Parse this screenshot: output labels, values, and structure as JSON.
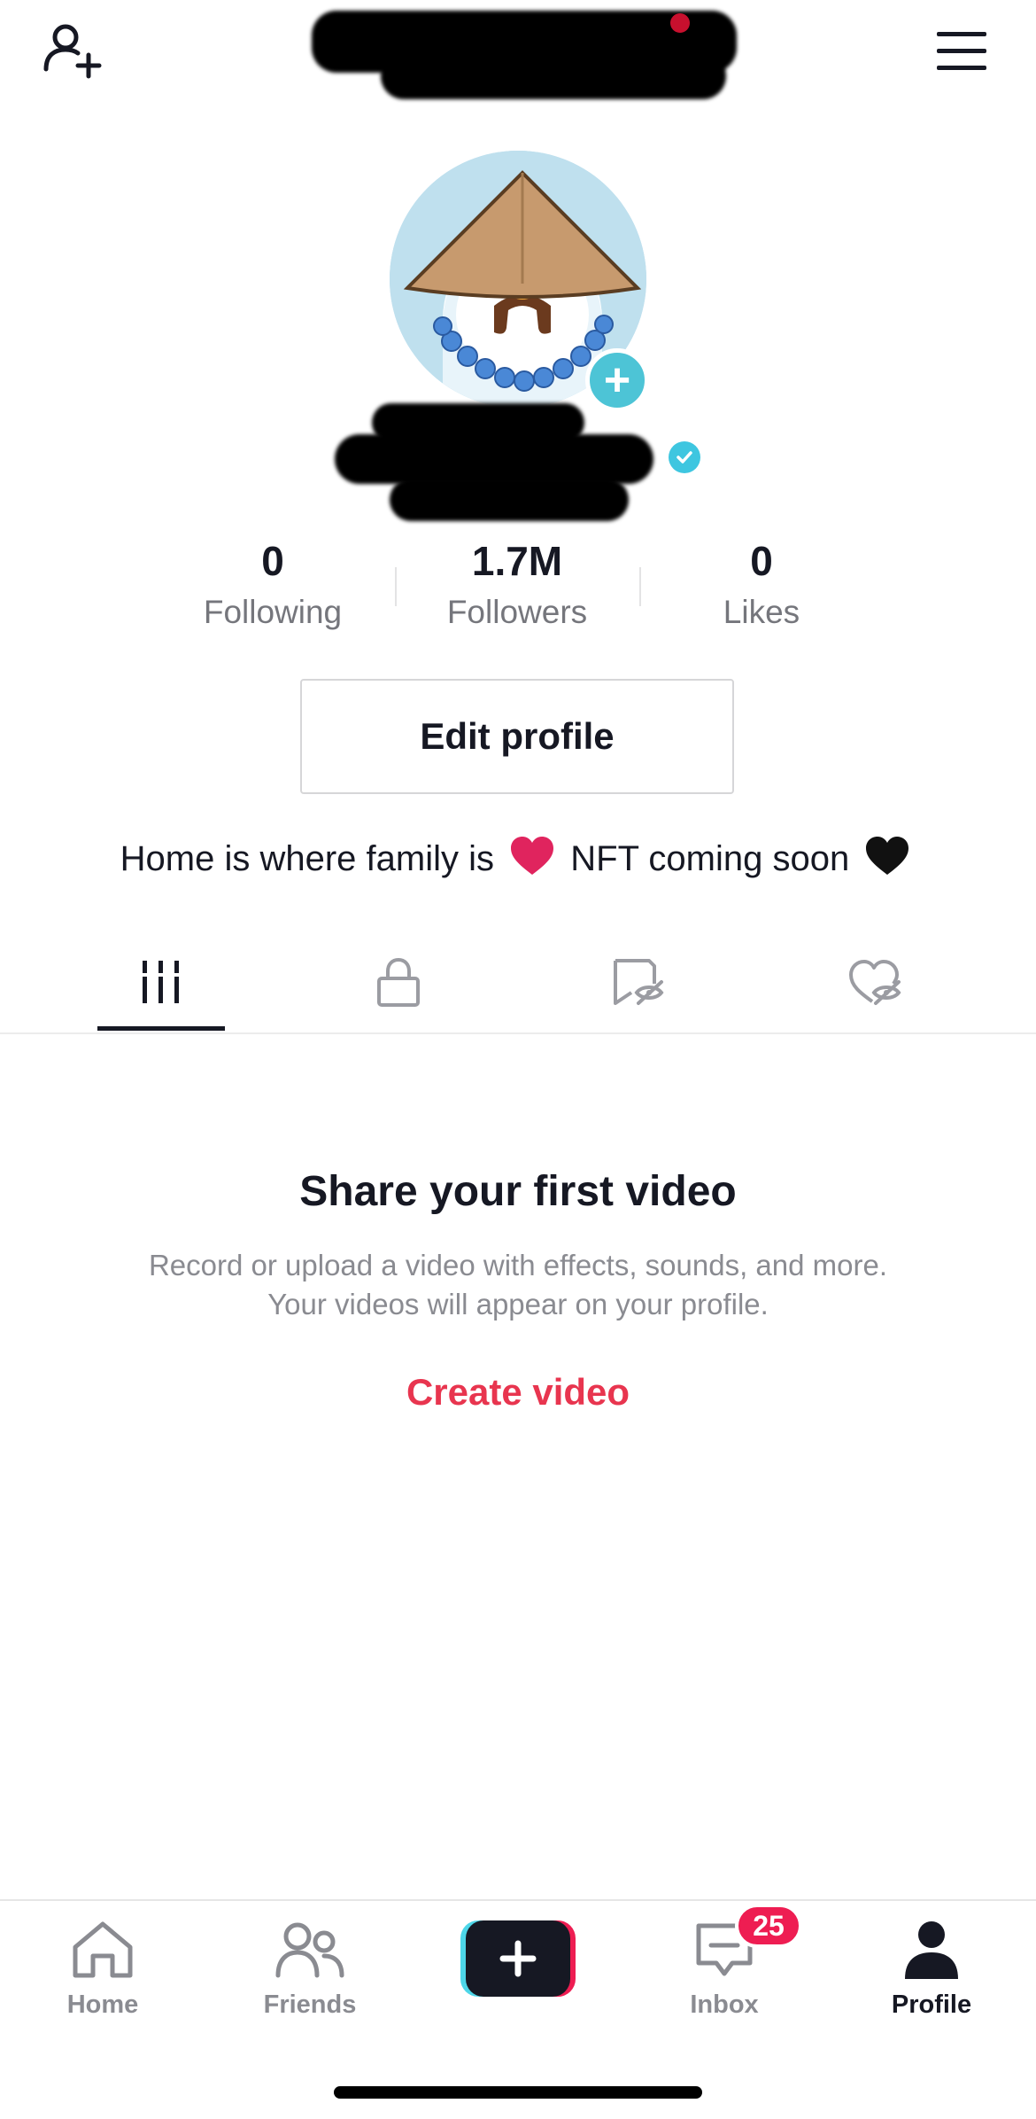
{
  "header": {
    "add_friend_icon": "person-add-icon",
    "menu_icon": "hamburger-menu-icon",
    "username_redacted": true
  },
  "profile": {
    "handle_redacted": true,
    "verified_icon": "verified-check-icon",
    "add_photo_icon": "plus-icon"
  },
  "stats": {
    "following": {
      "value": "0",
      "label": "Following"
    },
    "followers": {
      "value": "1.7M",
      "label": "Followers"
    },
    "likes": {
      "value": "0",
      "label": "Likes"
    }
  },
  "edit_profile_label": "Edit profile",
  "bio": {
    "part1": "Home is where family is",
    "part2": "NFT coming soon",
    "heart1_color": "#e0245e",
    "heart2_color": "#111111"
  },
  "tabs": [
    {
      "icon": "grid-videos-icon",
      "active": true
    },
    {
      "icon": "lock-icon",
      "active": false
    },
    {
      "icon": "hidden-bookmark-icon",
      "active": false
    },
    {
      "icon": "hidden-likes-icon",
      "active": false
    }
  ],
  "empty_state": {
    "title": "Share your first video",
    "line1": "Record or upload a video with effects, sounds, and more.",
    "line2": "Your videos will appear on your profile.",
    "cta": "Create video"
  },
  "bottom_nav": {
    "home": "Home",
    "friends": "Friends",
    "inbox": "Inbox",
    "inbox_badge": "25",
    "profile": "Profile",
    "create_icon": "plus-icon"
  },
  "colors": {
    "accent_red": "#e8354f",
    "badge_red": "#ee1d52",
    "cyan": "#4dc4d6",
    "text": "#161823",
    "muted": "#8a8b91"
  }
}
